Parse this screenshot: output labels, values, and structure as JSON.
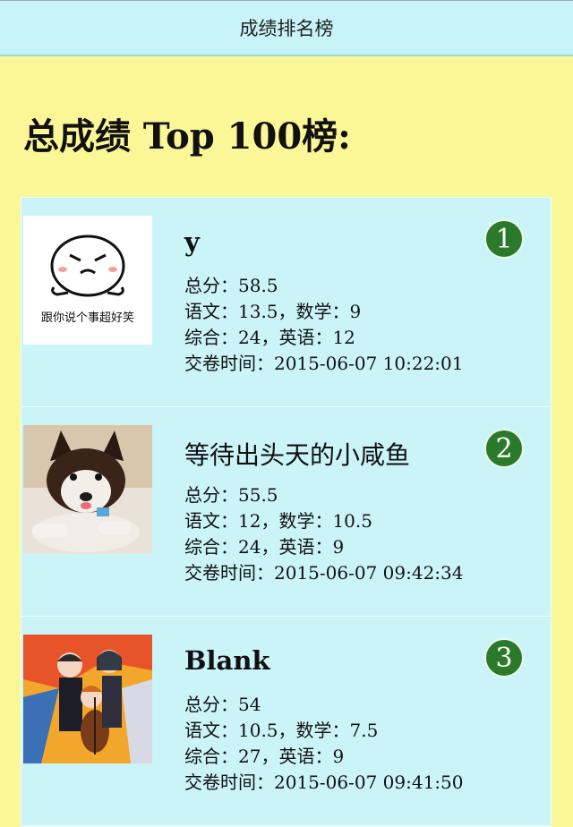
{
  "header": {
    "title": "成绩排名榜"
  },
  "heading": "总成绩 Top 100榜:",
  "entries": [
    {
      "rank": "1",
      "name": "y",
      "avatar_caption": "跟你说个事超好笑",
      "total": "总分：58.5",
      "line2": "语文：13.5，数学：9",
      "line3": "综合：24，英语：12",
      "time": "交卷时间：2015-06-07 10:22:01"
    },
    {
      "rank": "2",
      "name": "等待出头天的小咸鱼",
      "total": "总分：55.5",
      "line2": "语文：12，数学：10.5",
      "line3": "综合：24，英语：9",
      "time": "交卷时间：2015-06-07 09:42:34"
    },
    {
      "rank": "3",
      "name": "Blank",
      "total": "总分：54",
      "line2": "语文：10.5，数学：7.5",
      "line3": "综合：27，英语：9",
      "time": "交卷时间：2015-06-07 09:41:50"
    }
  ]
}
